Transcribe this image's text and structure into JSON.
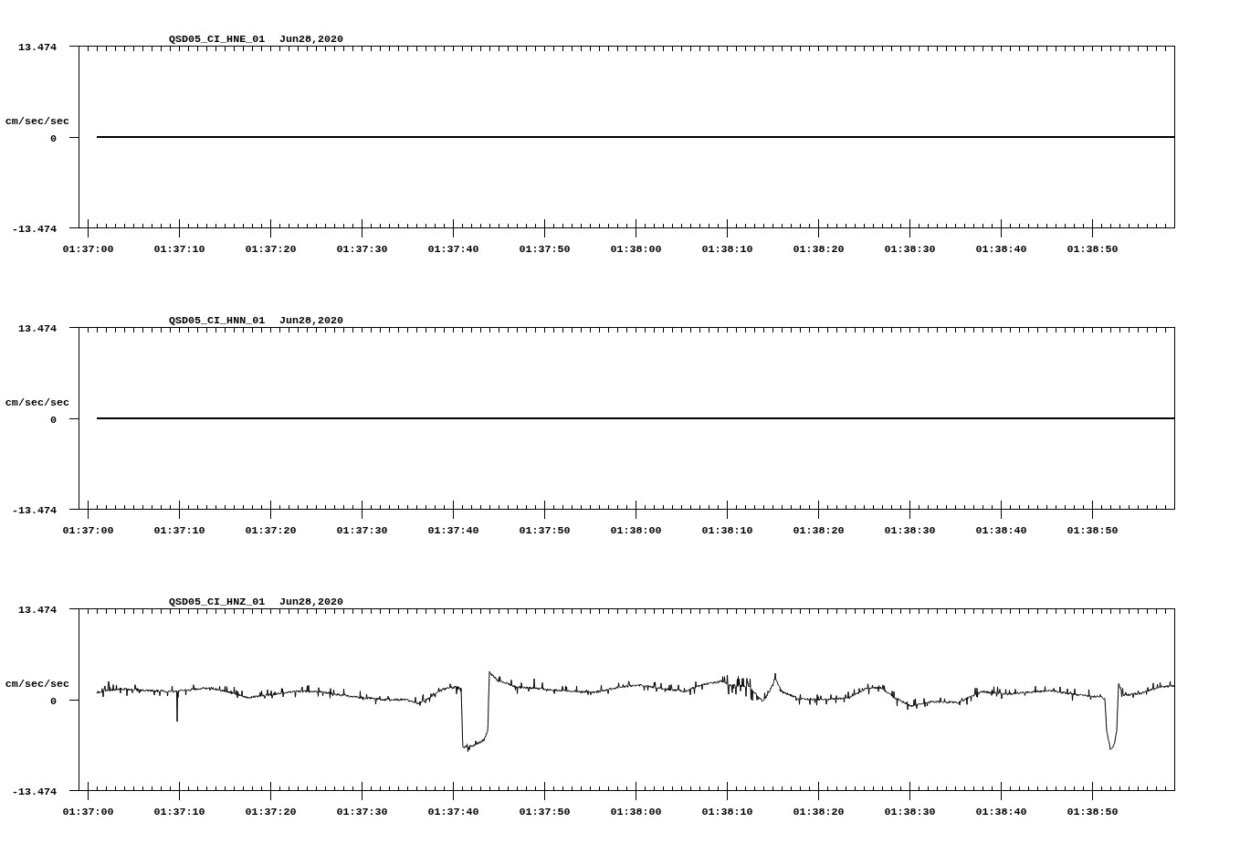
{
  "panels": [
    {
      "kind": "flat",
      "channel": "QSD05_CI_HNE_01",
      "date": "Jun28,2020",
      "unit": "cm/sec/sec",
      "y_labels": [
        "13.474",
        "0",
        "-13.474"
      ],
      "x_labels": [
        "01:37:00",
        "01:37:10",
        "01:37:20",
        "01:37:30",
        "01:37:40",
        "01:37:50",
        "01:38:00",
        "01:38:10",
        "01:38:20",
        "01:38:30",
        "01:38:40",
        "01:38:50"
      ]
    },
    {
      "kind": "flat",
      "channel": "QSD05_CI_HNN_01",
      "date": "Jun28,2020",
      "unit": "cm/sec/sec",
      "y_labels": [
        "13.474",
        "0",
        "-13.474"
      ],
      "x_labels": [
        "01:37:00",
        "01:37:10",
        "01:37:20",
        "01:37:30",
        "01:37:40",
        "01:37:50",
        "01:38:00",
        "01:38:10",
        "01:38:20",
        "01:38:30",
        "01:38:40",
        "01:38:50"
      ]
    },
    {
      "kind": "signal",
      "channel": "QSD05_CI_HNZ_01",
      "date": "Jun28,2020",
      "unit": "cm/sec/sec",
      "y_labels": [
        "13.474",
        "0",
        "-13.474"
      ],
      "x_labels": [
        "01:37:00",
        "01:37:10",
        "01:37:20",
        "01:37:30",
        "01:37:40",
        "01:37:50",
        "01:38:00",
        "01:38:10",
        "01:38:20",
        "01:38:30",
        "01:38:40",
        "01:38:50"
      ]
    }
  ]
}
